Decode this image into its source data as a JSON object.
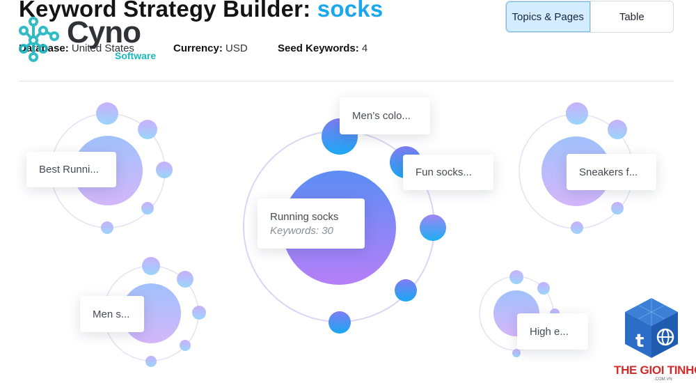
{
  "header": {
    "title_prefix": "Keyword Strategy Builder:",
    "title_keyword": "socks",
    "database_label": "Database:",
    "database_value": "United States",
    "currency_label": "Currency:",
    "currency_value": "USD",
    "seed_label": "Seed Keywords:",
    "seed_value": "4"
  },
  "view_toggle": {
    "options": [
      {
        "label": "Topics & Pages",
        "active": true
      },
      {
        "label": "Table",
        "active": false
      }
    ]
  },
  "clusters": {
    "main": {
      "label": "Running socks",
      "sub": "Keywords: 30"
    },
    "satellite_1": {
      "label": "Men’s colo..."
    },
    "satellite_2": {
      "label": "Fun socks..."
    },
    "best_running": {
      "label": "Best Runni..."
    },
    "sneakers": {
      "label": "Sneakers f..."
    },
    "men_s": {
      "label": "Men s..."
    },
    "high_e": {
      "label": "High e..."
    }
  },
  "watermarks": {
    "cyno": "Cyno",
    "cyno_sub": "Software",
    "tgt": "THE GIOI TINHOC",
    "tgt_sub": ".COM.VN"
  },
  "colors": {
    "accent": "#1aa7ec",
    "bubble_blue": "#3da6f5",
    "bubble_purple": "#b988f2",
    "orbit": "#d9d6f5"
  }
}
